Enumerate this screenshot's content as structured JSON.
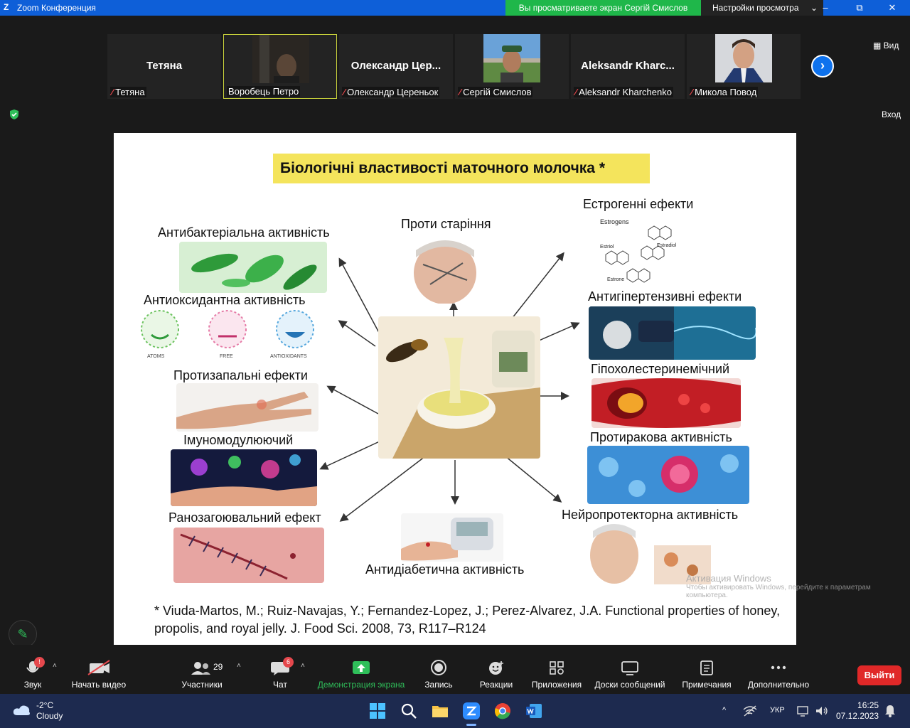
{
  "window": {
    "app_logo": "Z",
    "title": "Zoom Конференция",
    "minimize": "–",
    "maximize": "⧉",
    "close": "✕"
  },
  "share_banner": {
    "text": "Вы просматриваете экран Сергій Смислов"
  },
  "view_options": {
    "label": "Настройки просмотра",
    "chevron": "⌄"
  },
  "participants_strip": {
    "tiles": [
      {
        "big_name": "Тетяна",
        "label": "Тетяна",
        "muted": true,
        "video": false
      },
      {
        "big_name": "",
        "label": "Воробець Петро",
        "muted": false,
        "video": true,
        "active": true
      },
      {
        "big_name": "Олександр Цер...",
        "label": "Олександр Цереньок",
        "muted": true,
        "video": false
      },
      {
        "big_name": "",
        "label": "Сергій Смислов",
        "muted": true,
        "video": true
      },
      {
        "big_name": "Aleksandr Kharc...",
        "label": "Aleksandr Kharchenko",
        "muted": true,
        "video": false
      },
      {
        "big_name": "",
        "label": "Микола Повод",
        "muted": true,
        "video": true
      }
    ],
    "next_label": "›",
    "mute_icon_glyph": "🎙"
  },
  "view_button": {
    "label": "Вид"
  },
  "enter_button": {
    "label": "Вход"
  },
  "slide": {
    "title": "Біологічні властивості маточного молочка *",
    "captions": {
      "antibacterial": "Антибактеріальна активність",
      "antiaging": "Проти старіння",
      "estrogenic": "Естрогенні ефекти",
      "antioxidant": "Антиоксидантна активність",
      "antihypertensive": "Антигіпертензивні ефекти",
      "antiinflammatory": "Протизапальні ефекти",
      "hypocholesterol": "Гіпохолестеринемічний",
      "immunomodulating": "Імуномодулюючий",
      "anticancer": "Протиракова активність",
      "woundhealing": "Ранозагоювальний ефект",
      "neuroprotective": "Нейропротекторна активність",
      "antidiabetic": "Антидіабетична активність"
    },
    "estrogen_labels": {
      "top": "Estrogens",
      "estriol": "Estriol",
      "estradiol": "Estradiol",
      "estrone": "Estrone"
    },
    "antioxidant_labels": {
      "atoms": "ATOMS",
      "free": "FREE",
      "antioxidants": "ANTIOXIDANTS"
    },
    "citation": "* Viuda-Martos, M.; Ruiz-Navajas, Y.; Fernandez-Lopez, J.; Perez-Alvarez, J.A. Functional properties of honey, propolis, and royal jelly. J. Food Sci. 2008, 73, R117–R124"
  },
  "activation_watermark": {
    "title": "Активация Windows",
    "subtitle": "Чтобы активировать Windows, перейдите к параметрам компьютера."
  },
  "toolbar": {
    "audio": {
      "label": "Звук",
      "alert_badge": "!"
    },
    "video": {
      "label": "Начать видео"
    },
    "participants": {
      "label": "Участники",
      "count": "29"
    },
    "chat": {
      "label": "Чат",
      "badge": "6"
    },
    "share": {
      "label": "Демонстрация экрана"
    },
    "record": {
      "label": "Запись"
    },
    "reactions": {
      "label": "Реакции"
    },
    "apps": {
      "label": "Приложения"
    },
    "whiteboards": {
      "label": "Доски сообщений"
    },
    "notes": {
      "label": "Примечания"
    },
    "more": {
      "label": "Дополнительно"
    },
    "leave": {
      "label": "Выйти"
    },
    "caret": "˄"
  },
  "taskbar": {
    "weather": {
      "temp": "-2°C",
      "desc": "Cloudy"
    },
    "language": "УКР",
    "time": "16:25",
    "date": "07.12.2023",
    "tray_up": "^"
  },
  "colors": {
    "zoom_blue": "#0e72ed",
    "share_green": "#1fb74a",
    "leave_red": "#e02828",
    "title_yellow": "#f4e45c"
  }
}
